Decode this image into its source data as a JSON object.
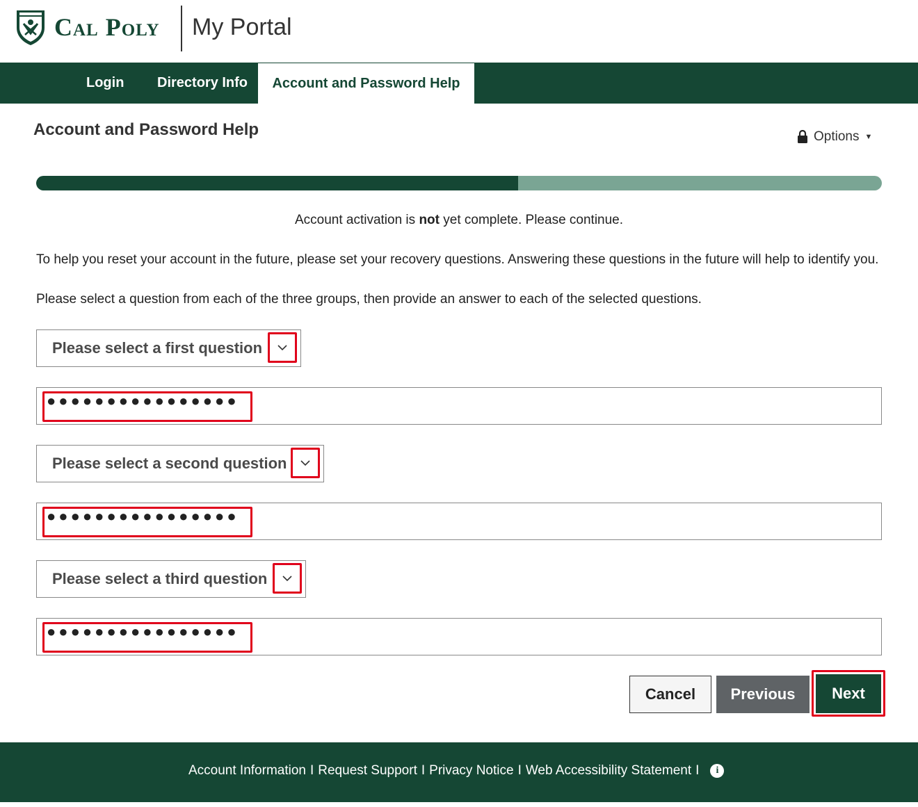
{
  "header": {
    "brand": "Cal Poly",
    "portal_title": "My Portal"
  },
  "nav": {
    "items": [
      {
        "label": "Login"
      },
      {
        "label": "Directory Info"
      },
      {
        "label": "Account and Password Help",
        "active": true
      }
    ]
  },
  "page": {
    "heading": "Account and Password Help",
    "options_label": "Options",
    "progress_fraction": 0.57,
    "status_prefix": "Account activation is ",
    "status_bold": "not",
    "status_suffix": " yet complete. Please continue.",
    "para1": "To help you reset your account in the future, please set your recovery questions. Answering these questions in the future will help to identify you.",
    "para2": "Please select a question from each of the three groups, then provide an answer to each of the selected questions."
  },
  "questions": [
    {
      "select_label": "Please select a first question",
      "answer_mask": "●●●●●●●●●●●●●●●●"
    },
    {
      "select_label": "Please select a second question",
      "answer_mask": "●●●●●●●●●●●●●●●●"
    },
    {
      "select_label": "Please select a third question",
      "answer_mask": "●●●●●●●●●●●●●●●●"
    }
  ],
  "buttons": {
    "cancel": "Cancel",
    "previous": "Previous",
    "next": "Next"
  },
  "footer": {
    "links": [
      "Account Information",
      "Request Support",
      "Privacy Notice",
      "Web Accessibility Statement"
    ],
    "separator": "I"
  },
  "colors": {
    "brand_green": "#154734",
    "progress_track": "#7aa594",
    "highlight_red": "#e0001b",
    "previous_gray": "#5f6366"
  },
  "icons": [
    "shield-logo-icon",
    "lock-icon",
    "caret-down-icon",
    "chevron-down-icon",
    "info-icon"
  ]
}
